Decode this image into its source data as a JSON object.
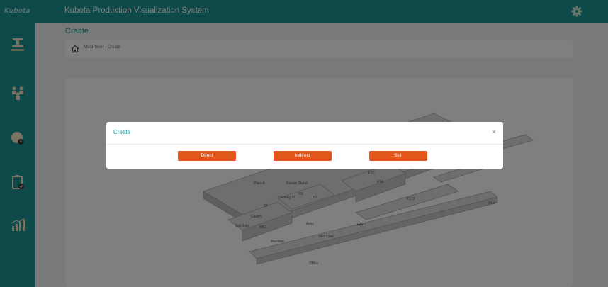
{
  "app": {
    "logo_text": "Kubota",
    "title": "Kubota Production Visualization System"
  },
  "sidebar": {
    "items": [
      {
        "icon": "production-line-icon"
      },
      {
        "icon": "manpower-group-icon"
      },
      {
        "icon": "user-time-icon"
      },
      {
        "icon": "clipboard-check-icon"
      },
      {
        "icon": "chart-growth-icon"
      }
    ]
  },
  "header": {
    "settings_icon": "gear-icon"
  },
  "page": {
    "title": "Create",
    "breadcrumb": "ManPower - Create"
  },
  "map": {
    "labels": [
      "Plant A",
      "Kaizen Stand",
      "F1",
      "F2",
      "Fire",
      "Office",
      "PC 3",
      "SF",
      "FS1",
      "FS2",
      "MS2",
      "Machine",
      "Mid Case",
      "Docking SI",
      "Gallery",
      "Assy",
      "Sub Eng",
      "FAR2"
    ]
  },
  "modal": {
    "title": "Create",
    "close_label": "×",
    "buttons": {
      "direct": "Direct",
      "indirect": "Indirect",
      "skill": "Skill"
    }
  },
  "colors": {
    "teal": "#1e9494",
    "orange": "#e2561c"
  }
}
